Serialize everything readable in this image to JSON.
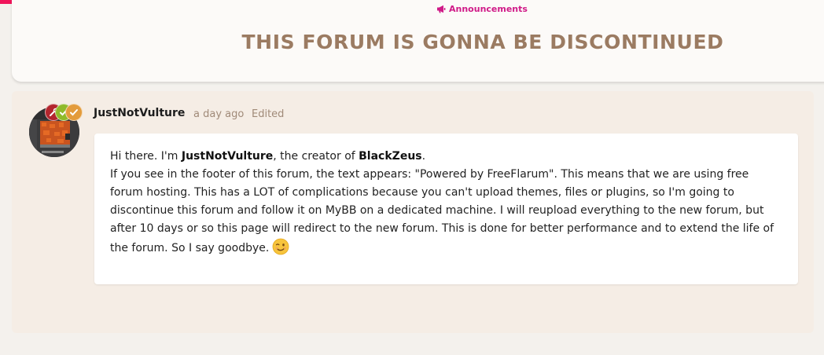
{
  "header": {
    "accent_color": "#f0145a",
    "tag": {
      "label": "Announcements",
      "icon": "bullhorn-icon",
      "color": "#d01a88"
    },
    "title": "THIS FORUM IS GONNA BE DISCONTINUED"
  },
  "post": {
    "author": "JustNotVulture",
    "time": "a day ago",
    "edited": "Edited",
    "badges": [
      {
        "icon": "wrench-icon",
        "color": "#b3262e"
      },
      {
        "icon": "check-icon",
        "color": "#8fba2a"
      },
      {
        "icon": "check-icon",
        "color": "#e39b3b"
      }
    ],
    "body": {
      "greeting_prefix": "Hi there. I'm ",
      "greeting_name": "JustNotVulture",
      "greeting_mid": ", the creator of ",
      "greeting_project": "BlackZeus",
      "greeting_suffix": ".",
      "paragraph": "If you see in the footer of this forum, the text appears: \"Powered by FreeFlarum\". This means that we are using free forum hosting. This has a LOT of complications because you can't upload themes, files or plugins, so I'm going to discontinue this forum and follow it on MyBB on a dedicated machine. I will reupload everything to the new forum, but after 10 days or so this page will redirect to the new forum. This is done for better performance and to extend the life of the forum. So I say goodbye.",
      "emoji": "winking-face-emoji"
    }
  }
}
